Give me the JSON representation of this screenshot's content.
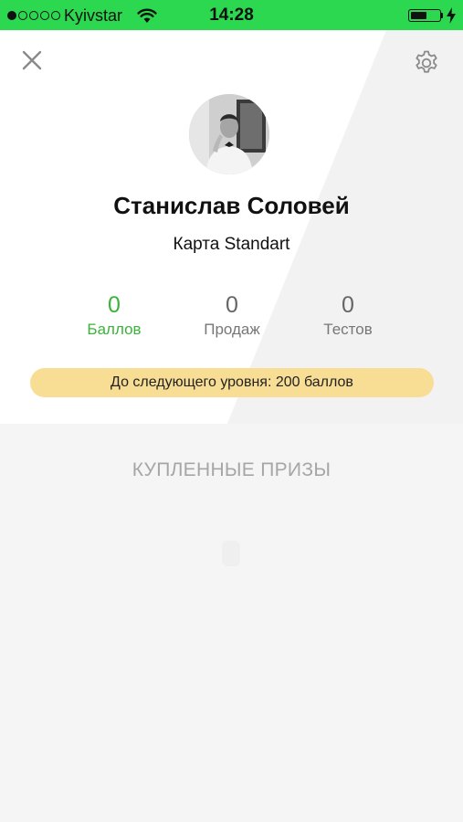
{
  "status_bar": {
    "carrier": "Kyivstar",
    "time": "14:28",
    "signal_bars_filled": 1,
    "signal_bars_total": 5,
    "battery_level": 0.6,
    "background_color": "#2bd84f",
    "icons": [
      "wifi-icon",
      "battery-icon",
      "charging-bolt-icon"
    ]
  },
  "header": {
    "close_icon": "close-icon",
    "settings_icon": "gear-icon"
  },
  "profile": {
    "name": "Станислав Соловей",
    "card_type": "Карта Standart",
    "avatar": "avatar-photo"
  },
  "stats": [
    {
      "value": "0",
      "label": "Баллов",
      "active": true
    },
    {
      "value": "0",
      "label": "Продаж",
      "active": false
    },
    {
      "value": "0",
      "label": "Тестов",
      "active": false
    }
  ],
  "level": {
    "text": "До следующего уровня: 200 баллов",
    "color": "#f8dd94"
  },
  "prizes": {
    "title": "КУПЛЕННЫЕ ПРИЗЫ"
  },
  "colors": {
    "accent_green": "#3bb33b"
  }
}
